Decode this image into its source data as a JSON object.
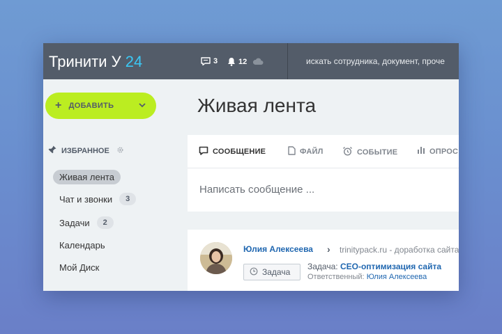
{
  "header": {
    "logo_text": "Тринити У",
    "logo_number": "24",
    "messages_count": "3",
    "notifications_count": "12",
    "search_text": "искать сотрудника, документ, проче"
  },
  "sidebar": {
    "add_button_label": "ДОБАВИТЬ",
    "favorites_label": "ИЗБРАННОЕ",
    "items": [
      {
        "label": "Живая лента",
        "badge": ""
      },
      {
        "label": "Чат и звонки",
        "badge": "3"
      },
      {
        "label": "Задачи",
        "badge": "2"
      },
      {
        "label": "Календарь",
        "badge": ""
      },
      {
        "label": "Мой Диск",
        "badge": ""
      }
    ]
  },
  "main": {
    "title": "Живая лента",
    "tabs": [
      {
        "label": "СООБЩЕНИЕ"
      },
      {
        "label": "ФАЙЛ"
      },
      {
        "label": "СОБЫТИЕ"
      },
      {
        "label": "ОПРОС"
      }
    ],
    "compose_placeholder": "Написать сообщение ..."
  },
  "post": {
    "author": "Юлия Алексеева",
    "destination": "trinitypack.ru - доработка сайта",
    "task_button_label": "Задача",
    "task_prefix": "Задача:",
    "task_name": "СЕО-оптимизация сайта",
    "responsible_prefix": "Ответственный:",
    "responsible_name": "Юлия Алексеева"
  },
  "colors": {
    "topbar": "#535c69",
    "accent_green": "#bbed21",
    "logo_blue": "#3bc8f5",
    "link_blue": "#2067b0"
  }
}
